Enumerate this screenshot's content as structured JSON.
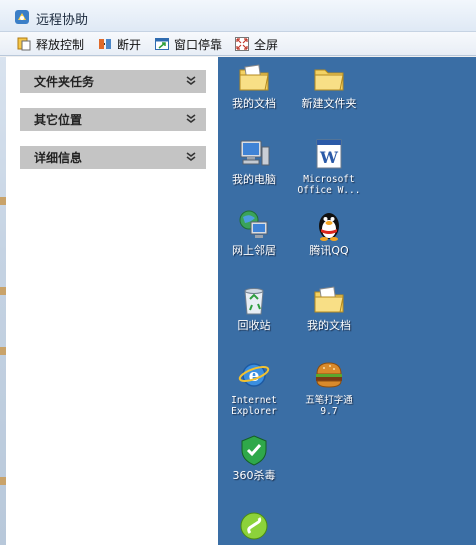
{
  "window": {
    "title": "远程协助"
  },
  "toolbar": {
    "release_control": "释放控制",
    "disconnect": "断开",
    "dock_window": "窗口停靠",
    "fullscreen": "全屏"
  },
  "taskpane": {
    "groups": [
      {
        "label": "文件夹任务"
      },
      {
        "label": "其它位置"
      },
      {
        "label": "详细信息"
      }
    ]
  },
  "desktop": {
    "icons": [
      {
        "label": "我的文档",
        "icon": "my-documents-folder-icon"
      },
      {
        "label": "新建文件夹",
        "icon": "folder-icon"
      },
      {
        "label": "我的电脑",
        "icon": "my-computer-icon"
      },
      {
        "label": "Microsoft\nOffice W...",
        "icon": "word-document-icon"
      },
      {
        "label": "网上邻居",
        "icon": "network-places-icon"
      },
      {
        "label": "腾讯QQ",
        "icon": "qq-penguin-icon"
      },
      {
        "label": "回收站",
        "icon": "recycle-bin-icon"
      },
      {
        "label": "我的文档",
        "icon": "my-documents-folder-icon"
      },
      {
        "label": "Internet\nExplorer",
        "icon": "internet-explorer-icon"
      },
      {
        "label": "五笔打字通\n9.7",
        "icon": "hamburger-icon"
      },
      {
        "label": "360杀毒",
        "icon": "shield-antivirus-icon"
      },
      {
        "label": "",
        "icon": "green-note-icon"
      }
    ]
  },
  "colors": {
    "desktop_bg": "#3a6ea5",
    "group_header": "#c4c4c4",
    "titlebar": "#dfe9f5"
  }
}
